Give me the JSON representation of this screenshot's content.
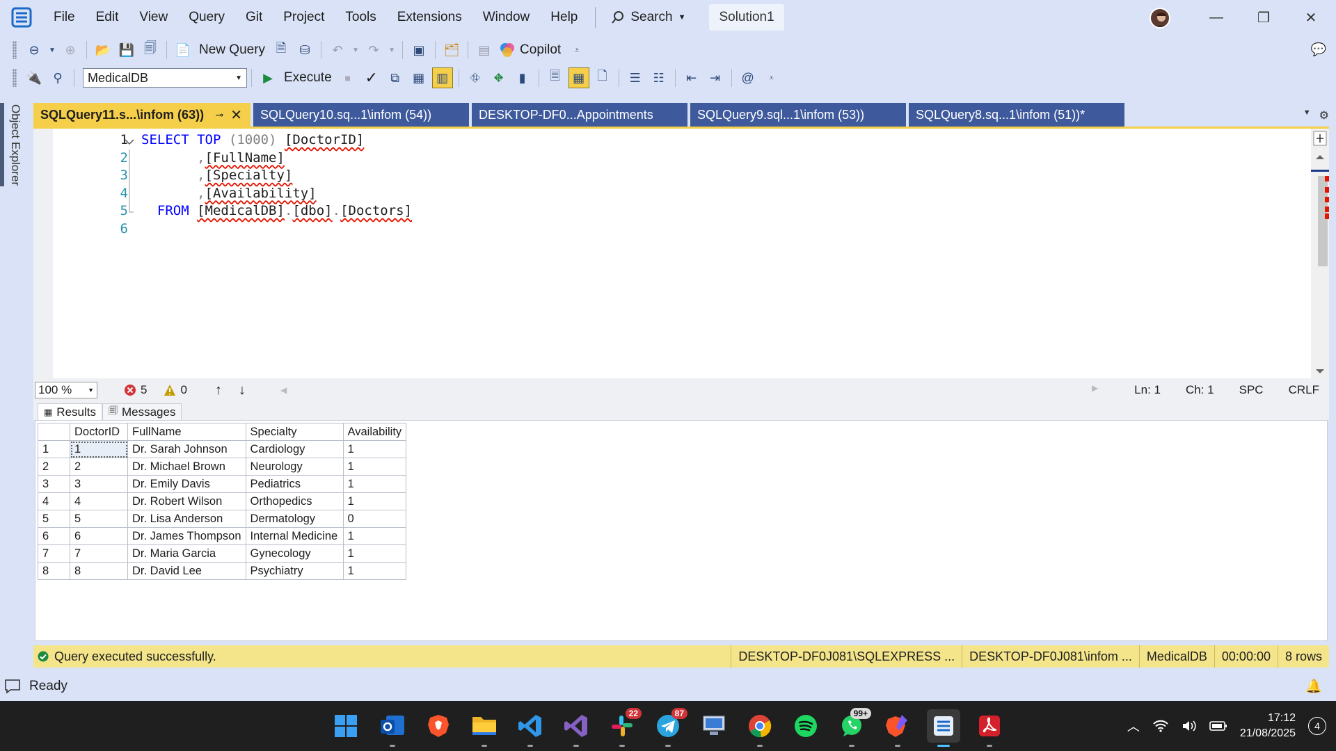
{
  "menu": {
    "items": [
      "File",
      "Edit",
      "View",
      "Query",
      "Git",
      "Project",
      "Tools",
      "Extensions",
      "Window",
      "Help"
    ],
    "search_label": "Search",
    "solution": "Solution1"
  },
  "toolbar": {
    "new_query": "New Query",
    "copilot": "Copilot",
    "database": "MedicalDB",
    "execute": "Execute"
  },
  "explorer": {
    "label": "Object Explorer"
  },
  "tabs": [
    {
      "label": "SQLQuery11.s...\\infom (63))"
    },
    {
      "label": "SQLQuery10.sq...1\\infom (54))"
    },
    {
      "label": "DESKTOP-DF0...Appointments"
    },
    {
      "label": "SQLQuery9.sql...1\\infom (53))"
    },
    {
      "label": "SQLQuery8.sq...1\\infom (51))*"
    }
  ],
  "editor": {
    "line_numbers": [
      "1",
      "2",
      "3",
      "4",
      "5",
      "6"
    ],
    "code": {
      "select": "SELECT",
      "top": "TOP",
      "top_num": "(1000)",
      "col1": "[DoctorID]",
      "col2": "[FullName]",
      "col3": "[Specialty]",
      "col4": "[Availability]",
      "from": "FROM",
      "db": "[MedicalDB]",
      "schema": "[dbo]",
      "table": "[Doctors]",
      "comma": ",",
      "dot": "."
    }
  },
  "editor_status": {
    "zoom": "100 %",
    "errors": "5",
    "warnings": "0",
    "ln": "Ln: 1",
    "ch": "Ch: 1",
    "spc": "SPC",
    "crlf": "CRLF"
  },
  "results": {
    "tabs": [
      "Results",
      "Messages"
    ],
    "columns": [
      "DoctorID",
      "FullName",
      "Specialty",
      "Availability"
    ],
    "rows": [
      [
        "1",
        "1",
        "Dr. Sarah Johnson",
        "Cardiology",
        "1"
      ],
      [
        "2",
        "2",
        "Dr. Michael Brown",
        "Neurology",
        "1"
      ],
      [
        "3",
        "3",
        "Dr. Emily Davis",
        "Pediatrics",
        "1"
      ],
      [
        "4",
        "4",
        "Dr. Robert Wilson",
        "Orthopedics",
        "1"
      ],
      [
        "5",
        "5",
        "Dr. Lisa Anderson",
        "Dermatology",
        "0"
      ],
      [
        "6",
        "6",
        "Dr. James Thompson",
        "Internal Medicine",
        "1"
      ],
      [
        "7",
        "7",
        "Dr. Maria Garcia",
        "Gynecology",
        "1"
      ],
      [
        "8",
        "8",
        "Dr. David Lee",
        "Psychiatry",
        "1"
      ]
    ]
  },
  "query_status": {
    "message": "Query executed successfully.",
    "server": "DESKTOP-DF0J081\\SQLEXPRESS ...",
    "user": "DESKTOP-DF0J081\\infom ...",
    "db": "MedicalDB",
    "time": "00:00:00",
    "rows": "8 rows"
  },
  "app_status": {
    "text": "Ready"
  },
  "taskbar": {
    "badges": {
      "slack": "22",
      "telegram": "87",
      "whatsapp": "99+"
    },
    "time": "17:12",
    "date": "21/08/2025",
    "notifications": "4"
  },
  "colors": {
    "accent": "#f5cf4a",
    "tab_inactive": "#3e5a9c",
    "chrome": "#d9e2f6",
    "keyword": "#0000ff",
    "status_bar": "#f4e58b"
  }
}
